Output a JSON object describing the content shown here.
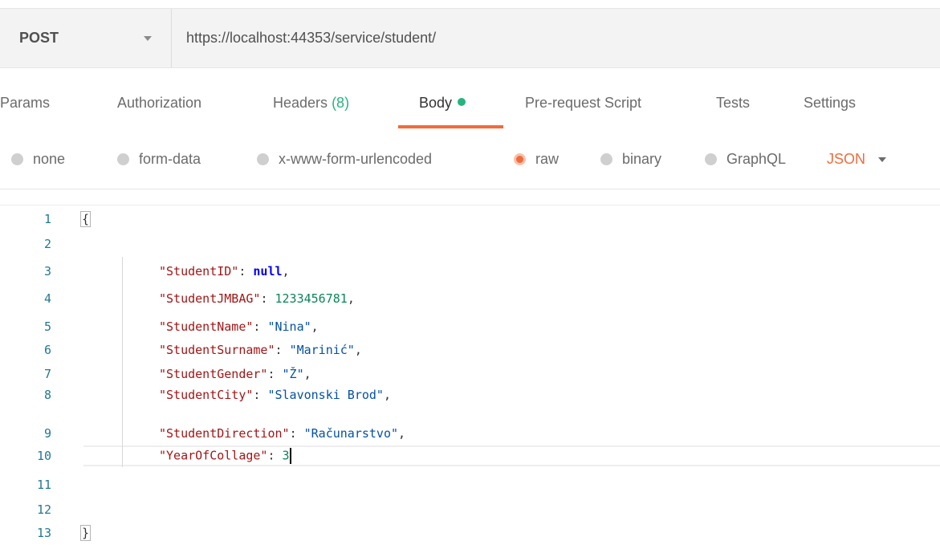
{
  "request": {
    "method": "POST",
    "url": "https://localhost:44353/service/student/"
  },
  "tabs": [
    {
      "label": "Params"
    },
    {
      "label": "Authorization"
    },
    {
      "label": "Headers",
      "count": "(8)"
    },
    {
      "label": "Body",
      "active": true
    },
    {
      "label": "Pre-request Script"
    },
    {
      "label": "Tests"
    },
    {
      "label": "Settings"
    }
  ],
  "body_types": [
    {
      "label": "none"
    },
    {
      "label": "form-data"
    },
    {
      "label": "x-www-form-urlencoded"
    },
    {
      "label": "raw",
      "selected": true
    },
    {
      "label": "binary"
    },
    {
      "label": "GraphQL"
    }
  ],
  "format": "JSON",
  "editor": {
    "line_numbers": [
      "1",
      "2",
      "3",
      "4",
      "5",
      "6",
      "7",
      "8",
      "9",
      "10",
      "11",
      "12",
      "13"
    ],
    "open_brace": "{",
    "close_brace": "}",
    "fields": [
      {
        "key": "\"StudentID\"",
        "value": "null",
        "type": "keyword",
        "sep": ","
      },
      {
        "key": "\"StudentJMBAG\"",
        "value": "1233456781",
        "type": "number",
        "sep": ","
      },
      {
        "key": "\"StudentName\"",
        "value": "\"Nina\"",
        "type": "string",
        "sep": ","
      },
      {
        "key": "\"StudentSurname\"",
        "value": "\"Marinić\"",
        "type": "string",
        "sep": ","
      },
      {
        "key": "\"StudentGender\"",
        "value": "\"Ž\"",
        "type": "string",
        "sep": ","
      },
      {
        "key": "\"StudentCity\"",
        "value": "\"Slavonski Brod\"",
        "type": "string",
        "sep": ","
      },
      {
        "key": "\"StudentDirection\"",
        "value": "\"Računarstvo\"",
        "type": "string",
        "sep": ","
      },
      {
        "key": "\"YearOfCollage\"",
        "value": "3",
        "type": "number",
        "sep": ""
      }
    ],
    "colon": ": "
  },
  "colors": {
    "accent": "#f26b3a",
    "status_green": "#26b47f"
  }
}
